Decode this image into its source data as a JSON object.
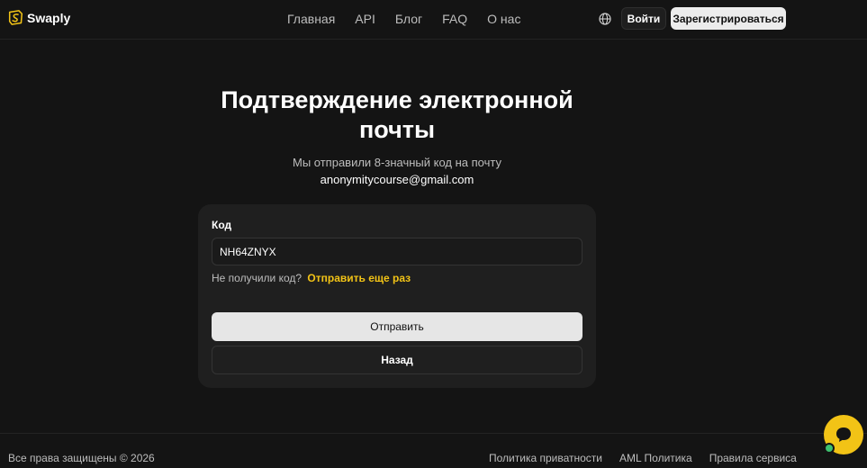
{
  "header": {
    "brand": "Swaply",
    "nav": [
      "Главная",
      "API",
      "Блог",
      "FAQ",
      "О нас"
    ],
    "language_icon": "globe-icon",
    "login_label": "Войти",
    "register_label": "Зарегистрироваться"
  },
  "main": {
    "title": "Подтверждение электронной почты",
    "subtitle": "Мы отправили 8-значный код на почту",
    "email": "anonymitycourse@gmail.com",
    "code_label": "Код",
    "code_value": "NH64ZNYX",
    "resend_prompt": "Не получили код?",
    "resend_link": "Отправить еще раз",
    "submit_label": "Отправить",
    "back_label": "Назад"
  },
  "footer": {
    "copyright": "Все права защищены © 2026",
    "links": [
      "Политика приватности",
      "AML Политика",
      "Правила сервиса"
    ]
  },
  "chat": {
    "icon": "chat-icon"
  },
  "colors": {
    "background": "#141414",
    "card": "#1f1f1f",
    "accent": "#f2c316",
    "online": "#3ec16f"
  }
}
